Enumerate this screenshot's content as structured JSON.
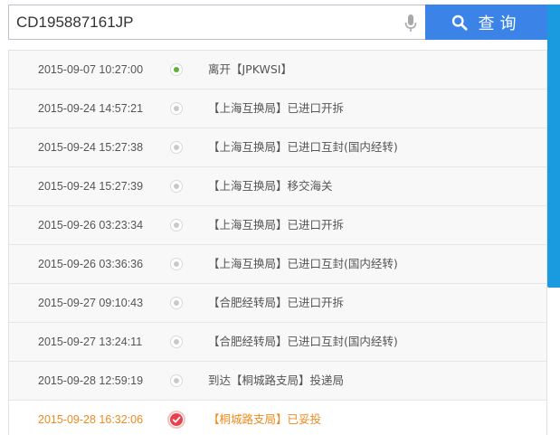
{
  "search": {
    "value": "CD195887161JP",
    "button_label": "查询"
  },
  "colors": {
    "accent": "#3b83e6",
    "side_bar": "#1a9be0",
    "active_dot": "#5cb531",
    "latest_text": "#f08a1c",
    "delivered_icon": "#e8414b"
  },
  "icons": {
    "mic": "microphone-icon",
    "search": "search-icon",
    "delivered": "check-circle-icon"
  },
  "timeline": [
    {
      "time": "2015-09-07 10:27:00",
      "status": "离开【JPKWSI】"
    },
    {
      "time": "2015-09-24 14:57:21",
      "status": "【上海互换局】已进口开拆"
    },
    {
      "time": "2015-09-24 15:27:38",
      "status": "【上海互换局】已进口互封(国内经转)"
    },
    {
      "time": "2015-09-24 15:27:39",
      "status": "【上海互换局】移交海关"
    },
    {
      "time": "2015-09-26 03:23:34",
      "status": "【上海互换局】已进口开拆"
    },
    {
      "time": "2015-09-26 03:36:36",
      "status": "【上海互换局】已进口互封(国内经转)"
    },
    {
      "time": "2015-09-27 09:10:43",
      "status": "【合肥经转局】已进口开拆"
    },
    {
      "time": "2015-09-27 13:24:11",
      "status": "【合肥经转局】已进口互封(国内经转)"
    },
    {
      "time": "2015-09-28 12:59:19",
      "status": "到达【桐城路支局】投递局"
    },
    {
      "time": "2015-09-28 16:32:06",
      "status": "【桐城路支局】已妥投"
    }
  ]
}
